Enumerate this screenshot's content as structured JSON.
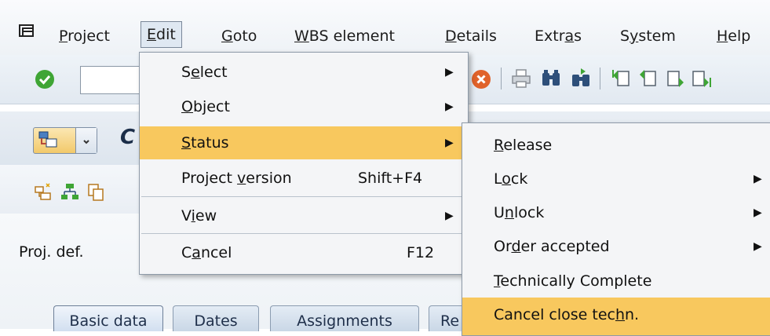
{
  "menubar": {
    "icon": "sap-menu-icon",
    "items": [
      {
        "pre": "",
        "u": "P",
        "post": "roject"
      },
      {
        "pre": "",
        "u": "E",
        "post": "dit"
      },
      {
        "pre": "",
        "u": "G",
        "post": "oto"
      },
      {
        "pre": "",
        "u": "W",
        "post": "BS element"
      },
      {
        "pre": "",
        "u": "D",
        "post": "etails"
      },
      {
        "pre": "Extr",
        "u": "a",
        "post": "s"
      },
      {
        "pre": "S",
        "u": "y",
        "post": "stem"
      },
      {
        "pre": "",
        "u": "H",
        "post": "elp"
      }
    ]
  },
  "toolbar": {
    "icons": [
      "enter-checkmark-icon",
      "command-field",
      "cancel-icon",
      "print-icon",
      "find-icon",
      "find-next-icon",
      "first-page-icon",
      "previous-page-icon",
      "next-page-icon",
      "last-page-icon"
    ]
  },
  "title": {
    "fragment": "C"
  },
  "content": {
    "proj_def_label": "Proj. def.",
    "tabs": [
      "Basic data",
      "Dates",
      "Assignments",
      "Re"
    ]
  },
  "edit_menu": {
    "items": [
      {
        "pre": "S",
        "u": "e",
        "post": "lect",
        "shortcut": "",
        "submenu": true
      },
      {
        "pre": "",
        "u": "O",
        "post": "bject",
        "shortcut": "",
        "submenu": true
      },
      {
        "pre": "",
        "u": "S",
        "post": "tatus",
        "shortcut": "",
        "submenu": true,
        "highlighted": true
      },
      {
        "pre": "Project ",
        "u": "v",
        "post": "ersion",
        "shortcut": "Shift+F4",
        "submenu": false
      },
      {
        "pre": "V",
        "u": "i",
        "post": "ew",
        "shortcut": "",
        "submenu": true
      },
      {
        "pre": "C",
        "u": "a",
        "post": "ncel",
        "shortcut": "F12",
        "submenu": false
      }
    ]
  },
  "status_menu": {
    "items": [
      {
        "pre": "",
        "u": "R",
        "post": "elease",
        "submenu": false
      },
      {
        "pre": "L",
        "u": "o",
        "post": "ck",
        "submenu": true
      },
      {
        "pre": "U",
        "u": "n",
        "post": "lock",
        "submenu": true
      },
      {
        "pre": "Or",
        "u": "d",
        "post": "er accepted",
        "submenu": true
      },
      {
        "pre": "",
        "u": "T",
        "post": "echnically Complete",
        "submenu": false
      },
      {
        "pre": "Cancel close tec",
        "u": "h",
        "post": "n.",
        "submenu": false,
        "highlighted": true
      }
    ]
  },
  "colors": {
    "highlight": "#f8c85e",
    "menu_bg": "#f4f5f7",
    "check_green": "#3fa535",
    "cancel_orange": "#e0622a"
  }
}
